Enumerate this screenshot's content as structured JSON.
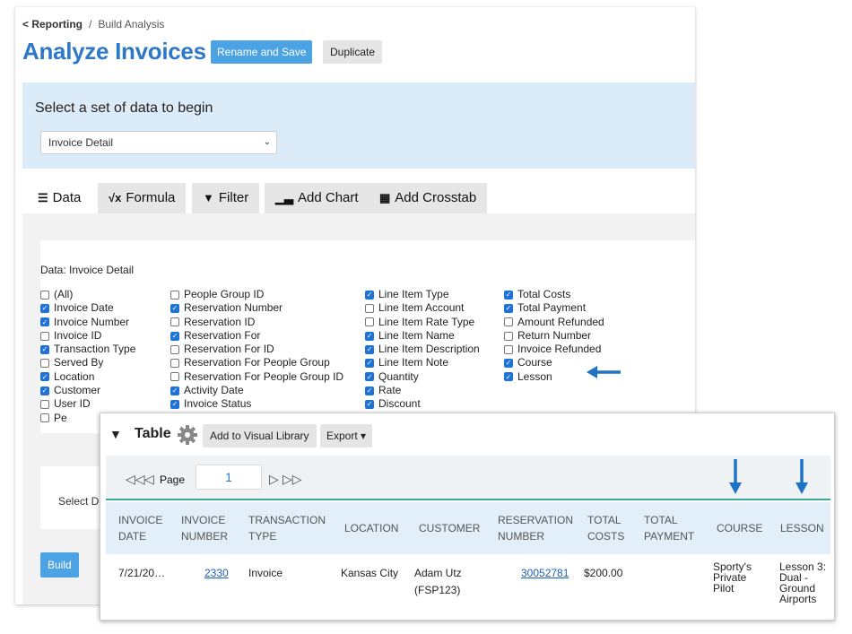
{
  "breadcrumb": {
    "back": "< Reporting",
    "sep": "/",
    "current": "Build Analysis"
  },
  "page_title": "Analyze Invoices",
  "buttons": {
    "rename_save": "Rename and Save",
    "duplicate": "Duplicate",
    "build": "Build"
  },
  "dataset": {
    "prompt": "Select a set of data to begin",
    "selected": "Invoice Detail"
  },
  "tabs": [
    {
      "label": "Data",
      "icon": "database-icon"
    },
    {
      "label": "Formula",
      "icon": "sqrt-icon"
    },
    {
      "label": "Filter",
      "icon": "filter-icon"
    },
    {
      "label": "Add Chart",
      "icon": "chart-icon"
    },
    {
      "label": "Add Crosstab",
      "icon": "table-icon"
    }
  ],
  "fields_title": "Data:  Invoice Detail",
  "columns": [
    [
      {
        "label": "(All)",
        "checked": false
      },
      {
        "label": "Invoice Date",
        "checked": true
      },
      {
        "label": "Invoice Number",
        "checked": true
      },
      {
        "label": "Invoice ID",
        "checked": false
      },
      {
        "label": "Transaction Type",
        "checked": true
      },
      {
        "label": "Served By",
        "checked": false
      },
      {
        "label": "Location",
        "checked": true
      },
      {
        "label": "Customer",
        "checked": true
      },
      {
        "label": "User ID",
        "checked": false
      },
      {
        "label": "Pe",
        "checked": false
      }
    ],
    [
      {
        "label": "People Group ID",
        "checked": false
      },
      {
        "label": "Reservation Number",
        "checked": true
      },
      {
        "label": "Reservation ID",
        "checked": false
      },
      {
        "label": "Reservation For",
        "checked": true
      },
      {
        "label": "Reservation For ID",
        "checked": false
      },
      {
        "label": "Reservation For People Group",
        "checked": false
      },
      {
        "label": "Reservation For People Group ID",
        "checked": false
      },
      {
        "label": "Activity Date",
        "checked": true
      },
      {
        "label": "Invoice Status",
        "checked": true
      }
    ],
    [
      {
        "label": "Line Item Type",
        "checked": true
      },
      {
        "label": "Line Item Account",
        "checked": false
      },
      {
        "label": "Line Item Rate Type",
        "checked": false
      },
      {
        "label": "Line Item Name",
        "checked": true
      },
      {
        "label": "Line Item Description",
        "checked": true
      },
      {
        "label": "Line Item Note",
        "checked": true
      },
      {
        "label": "Quantity",
        "checked": true
      },
      {
        "label": "Rate",
        "checked": true
      },
      {
        "label": "Discount",
        "checked": true
      }
    ],
    [
      {
        "label": "Total Costs",
        "checked": true
      },
      {
        "label": "Total Payment",
        "checked": true
      },
      {
        "label": "Amount Refunded",
        "checked": false
      },
      {
        "label": "Return Number",
        "checked": false
      },
      {
        "label": "Invoice Refunded",
        "checked": false
      },
      {
        "label": "Course",
        "checked": true
      },
      {
        "label": "Lesson",
        "checked": true
      }
    ]
  ],
  "select_d_label": "Select D",
  "table_panel": {
    "title": "Table",
    "add_library": "Add to Visual Library",
    "export": "Export ▾",
    "page_label": "Page",
    "page_value": "1",
    "headers": [
      [
        "INVOICE",
        "DATE"
      ],
      [
        "INVOICE",
        "NUMBER"
      ],
      [
        "TRANSACTION",
        "TYPE"
      ],
      [
        "LOCATION"
      ],
      [
        "CUSTOMER"
      ],
      [
        "RESERVATION",
        "NUMBER"
      ],
      [
        "TOTAL",
        "COSTS"
      ],
      [
        "TOTAL",
        "PAYMENT"
      ],
      [
        "COURSE"
      ],
      [
        "LESSON"
      ]
    ],
    "row": {
      "invoice_date": "7/21/20…",
      "invoice_number": "2330",
      "transaction_type": "Invoice",
      "location": "Kansas City",
      "customer": [
        "Adam Utz",
        "(FSP123)"
      ],
      "reservation_number": "30052781",
      "total_costs": "$200.00",
      "total_payment": "",
      "course": [
        "Sporty's",
        "Private",
        "Pilot"
      ],
      "lesson": [
        "Lesson 3:",
        "Dual -",
        "Ground",
        "Airports"
      ]
    }
  },
  "colors": {
    "title_blue": "#2e79c7",
    "button_blue": "#4ba3e3",
    "arrow_blue": "#1f73c7",
    "accent_teal": "#3aa89c"
  }
}
